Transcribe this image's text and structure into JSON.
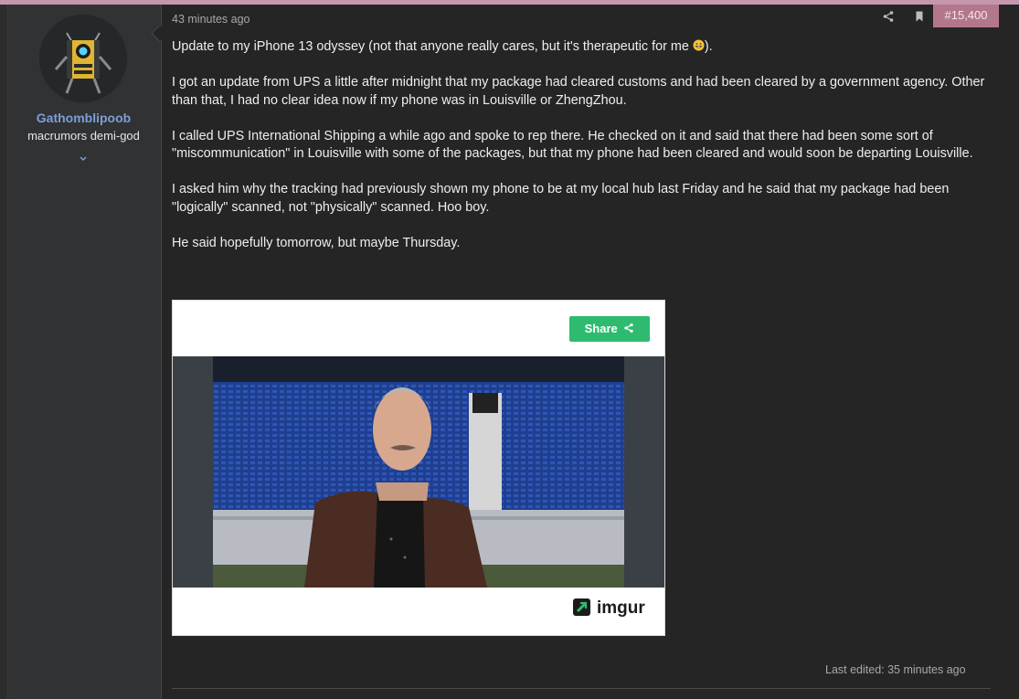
{
  "user": {
    "name": "Gathomblipoob",
    "title": "macrumors demi-god"
  },
  "post": {
    "timestamp": "43 minutes ago",
    "number": "#15,400",
    "paragraphs": [
      "Update to my iPhone 13 odyssey (not that anyone really cares, but it's therapeutic for me",
      "I got an update from UPS a little after midnight that my package had cleared customs and had been cleared by a government agency. Other than that, I had no clear idea now if my phone was in Louisville or ZhengZhou.",
      "I called UPS International Shipping a while ago and spoke to rep there. He checked on it and said that there had been some sort of \"miscommunication\" in Louisville with some of the packages, but that my phone had been cleared and would soon be departing Louisville.",
      "I asked him why the tracking had previously shown my phone to be at my local hub last Friday and he said that my package had been \"logically\" scanned, not \"physically\" scanned. Hoo boy.",
      "He said hopefully tomorrow, but maybe Thursday."
    ],
    "paragraph_end": ").",
    "last_edited": "Last edited: 35 minutes ago"
  },
  "embed": {
    "share_label": "Share",
    "provider": "imgur",
    "brand_color": "#2fbb6f"
  },
  "icons": {
    "share": "share-icon",
    "bookmark": "bookmark-icon",
    "expand": "chevron-down-icon",
    "emoji": "grinning-face-icon"
  },
  "colors": {
    "accent": "#b3778c",
    "topbar": "#c596ae",
    "username": "#7d9fd6",
    "background": "#252525"
  }
}
